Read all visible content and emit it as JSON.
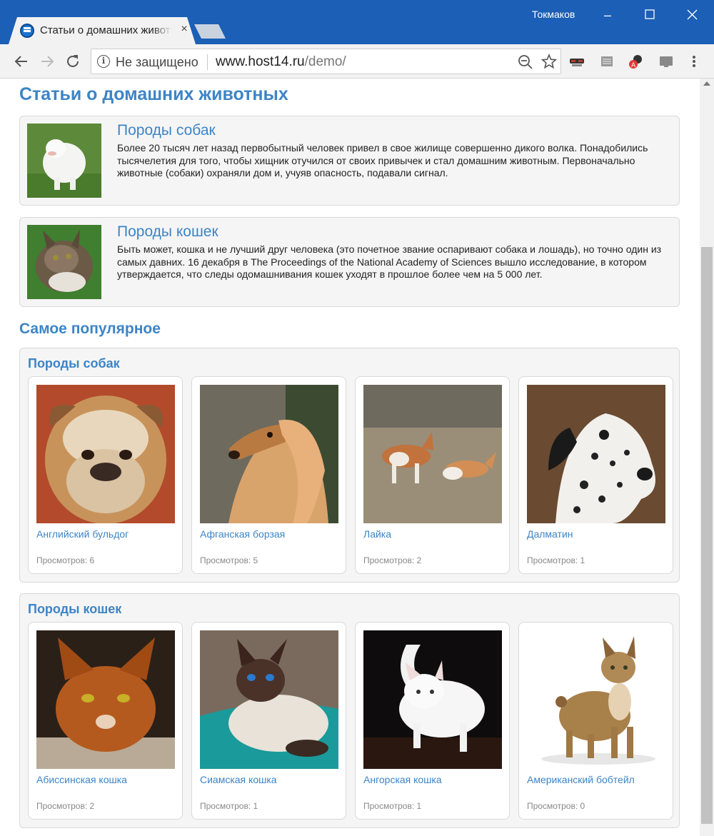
{
  "browser": {
    "tab_title": "Статьи о домашних животных",
    "user": "Токмаков",
    "security_label": "Не защищено",
    "url_host": "www.host14.ru",
    "url_path": "/demo/"
  },
  "page": {
    "title": "Статьи о домашних животных",
    "articles": [
      {
        "title": "Породы собак",
        "text": "Более 20 тысяч лет назад первобытный человек привел в свое жилище совершенно дикого волка. Понадобились тысячелетия для того, чтобы хищник отучился от своих привычек и стал домашним животным. Первоначально животные (собаки) охраняли дом и, учуяв опасность, подавали сигнал."
      },
      {
        "title": "Породы кошек",
        "text": "Быть может, кошка и не лучший друг человека (это почетное звание оспаривают собака и лошадь), но точно один из самых давних. 16 декабря в The Proceedings of the National Academy of Sciences вышло исследование, в котором утверждается, что следы одомашнивания кошек уходят в прошлое более чем на 5 000 лет."
      }
    ],
    "popular_title": "Самое популярное",
    "groups": [
      {
        "title": "Породы собак",
        "items": [
          {
            "name": "Английский бульдог",
            "views": "Просмотров: 6"
          },
          {
            "name": "Афганская борзая",
            "views": "Просмотров: 5"
          },
          {
            "name": "Лайка",
            "views": "Просмотров: 2"
          },
          {
            "name": "Далматин",
            "views": "Просмотров: 1"
          }
        ]
      },
      {
        "title": "Породы кошек",
        "items": [
          {
            "name": "Абиссинская кошка",
            "views": "Просмотров: 2"
          },
          {
            "name": "Сиамская кошка",
            "views": "Просмотров: 1"
          },
          {
            "name": "Ангорская кошка",
            "views": "Просмотров: 1"
          },
          {
            "name": "Американский бобтейл",
            "views": "Просмотров: 0"
          }
        ]
      }
    ]
  },
  "colors": {
    "titlebar": "#1b5fb6",
    "link": "#3d84c6",
    "panel_bg": "#f5f5f5"
  }
}
